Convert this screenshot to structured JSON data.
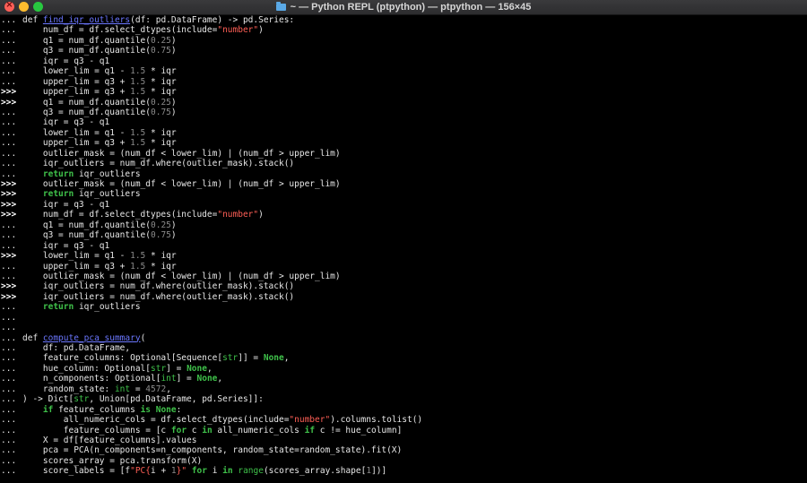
{
  "window": {
    "title": "~ — Python REPL (ptpython) — ptpython — 156×45",
    "folder_icon": "folder-icon"
  },
  "terminal": {
    "lines": [
      {
        "p": "...",
        "t": [
          [
            "",
            "def "
          ],
          [
            "fn",
            "find_iqr_outliers"
          ],
          [
            "",
            "(df: pd.DataFrame) -> pd.Series:"
          ]
        ]
      },
      {
        "p": "...",
        "t": [
          [
            "",
            "    num_df = df.select_dtypes(include="
          ],
          [
            "str",
            "\"number\""
          ],
          [
            "",
            ")"
          ]
        ]
      },
      {
        "p": "...",
        "t": [
          [
            "",
            "    q1 = num_df.quantile("
          ],
          [
            "num",
            "0.25"
          ],
          [
            "",
            ")"
          ]
        ]
      },
      {
        "p": "...",
        "t": [
          [
            "",
            "    q3 = num_df.quantile("
          ],
          [
            "num",
            "0.75"
          ],
          [
            "",
            ")"
          ]
        ]
      },
      {
        "p": "...",
        "t": [
          [
            "",
            "    iqr = q3 - q1"
          ]
        ]
      },
      {
        "p": "...",
        "t": [
          [
            "",
            "    lower_lim = q1 - "
          ],
          [
            "num",
            "1.5"
          ],
          [
            "",
            " * iqr"
          ]
        ]
      },
      {
        "p": "...",
        "t": [
          [
            "",
            "    upper_lim = q3 + "
          ],
          [
            "num",
            "1.5"
          ],
          [
            "",
            " * iqr"
          ]
        ]
      },
      {
        "p": ">>>",
        "t": [
          [
            "",
            "    upper_lim = q3 + "
          ],
          [
            "num",
            "1.5"
          ],
          [
            "",
            " * iqr"
          ]
        ]
      },
      {
        "p": ">>>",
        "t": [
          [
            "",
            "    q1 = num_df.quantile("
          ],
          [
            "num",
            "0.25"
          ],
          [
            "",
            ")"
          ]
        ]
      },
      {
        "p": "...",
        "t": [
          [
            "",
            "    q3 = num_df.quantile("
          ],
          [
            "num",
            "0.75"
          ],
          [
            "",
            ")"
          ]
        ]
      },
      {
        "p": "...",
        "t": [
          [
            "",
            "    iqr = q3 - q1"
          ]
        ]
      },
      {
        "p": "...",
        "t": [
          [
            "",
            "    lower_lim = q1 - "
          ],
          [
            "num",
            "1.5"
          ],
          [
            "",
            " * iqr"
          ]
        ]
      },
      {
        "p": "...",
        "t": [
          [
            "",
            "    upper_lim = q3 + "
          ],
          [
            "num",
            "1.5"
          ],
          [
            "",
            " * iqr"
          ]
        ]
      },
      {
        "p": "...",
        "t": [
          [
            "",
            "    outlier_mask = (num_df < lower_lim) | (num_df > upper_lim)"
          ]
        ]
      },
      {
        "p": "...",
        "t": [
          [
            "",
            "    iqr_outliers = num_df.where(outlier_mask).stack()"
          ]
        ]
      },
      {
        "p": "...",
        "t": [
          [
            "",
            "    "
          ],
          [
            "kw",
            "return"
          ],
          [
            "",
            " iqr_outliers"
          ]
        ]
      },
      {
        "p": ">>>",
        "t": [
          [
            "",
            "    outlier_mask = (num_df < lower_lim) | (num_df > upper_lim)"
          ]
        ]
      },
      {
        "p": ">>>",
        "t": [
          [
            "",
            "    "
          ],
          [
            "kw",
            "return"
          ],
          [
            "",
            " iqr_outliers"
          ]
        ]
      },
      {
        "p": ">>>",
        "t": [
          [
            "",
            "    iqr = q3 - q1"
          ]
        ]
      },
      {
        "p": ">>>",
        "t": [
          [
            "",
            "    num_df = df.select_dtypes(include="
          ],
          [
            "str",
            "\"number\""
          ],
          [
            "",
            ")"
          ]
        ]
      },
      {
        "p": "...",
        "t": [
          [
            "",
            "    q1 = num_df.quantile("
          ],
          [
            "num",
            "0.25"
          ],
          [
            "",
            ")"
          ]
        ]
      },
      {
        "p": "...",
        "t": [
          [
            "",
            "    q3 = num_df.quantile("
          ],
          [
            "num",
            "0.75"
          ],
          [
            "",
            ")"
          ]
        ]
      },
      {
        "p": "...",
        "t": [
          [
            "",
            "    iqr = q3 - q1"
          ]
        ]
      },
      {
        "p": ">>>",
        "t": [
          [
            "",
            "    lower_lim = q1 - "
          ],
          [
            "num",
            "1.5"
          ],
          [
            "",
            " * iqr"
          ]
        ]
      },
      {
        "p": "...",
        "t": [
          [
            "",
            "    upper_lim = q3 + "
          ],
          [
            "num",
            "1.5"
          ],
          [
            "",
            " * iqr"
          ]
        ]
      },
      {
        "p": "...",
        "t": [
          [
            "",
            "    outlier_mask = (num_df < lower_lim) | (num_df > upper_lim)"
          ]
        ]
      },
      {
        "p": ">>>",
        "t": [
          [
            "",
            "    iqr_outliers = num_df.where(outlier_mask).stack()"
          ]
        ]
      },
      {
        "p": ">>>",
        "t": [
          [
            "",
            "    iqr_outliers = num_df.where(outlier_mask).stack()"
          ]
        ]
      },
      {
        "p": "...",
        "t": [
          [
            "",
            "    "
          ],
          [
            "kw",
            "return"
          ],
          [
            "",
            " iqr_outliers"
          ]
        ]
      },
      {
        "p": "...",
        "t": []
      },
      {
        "p": "...",
        "t": []
      },
      {
        "p": "...",
        "t": [
          [
            "",
            "def "
          ],
          [
            "fn",
            "compute_pca_summary"
          ],
          [
            "",
            "("
          ]
        ]
      },
      {
        "p": "...",
        "t": [
          [
            "",
            "    df: pd.DataFrame,"
          ]
        ]
      },
      {
        "p": "...",
        "t": [
          [
            "",
            "    feature_columns: Optional[Sequence["
          ],
          [
            "ty",
            "str"
          ],
          [
            "",
            "]] = "
          ],
          [
            "kw",
            "None"
          ],
          [
            "",
            ","
          ]
        ]
      },
      {
        "p": "...",
        "t": [
          [
            "",
            "    hue_column: Optional["
          ],
          [
            "ty",
            "str"
          ],
          [
            "",
            "] = "
          ],
          [
            "kw",
            "None"
          ],
          [
            "",
            ","
          ]
        ]
      },
      {
        "p": "...",
        "t": [
          [
            "",
            "    n_components: Optional["
          ],
          [
            "ty",
            "int"
          ],
          [
            "",
            "] = "
          ],
          [
            "kw",
            "None"
          ],
          [
            "",
            ","
          ]
        ]
      },
      {
        "p": "...",
        "t": [
          [
            "",
            "    random_state: "
          ],
          [
            "ty",
            "int"
          ],
          [
            "",
            " = "
          ],
          [
            "num",
            "4572"
          ],
          [
            "",
            ","
          ]
        ]
      },
      {
        "p": "...",
        "t": [
          [
            "",
            ") -> Dict["
          ],
          [
            "ty",
            "str"
          ],
          [
            "",
            ", Union[pd.DataFrame, pd.Series]]:"
          ]
        ]
      },
      {
        "p": "...",
        "t": [
          [
            "",
            "    "
          ],
          [
            "kw",
            "if"
          ],
          [
            "",
            " feature_columns "
          ],
          [
            "kw",
            "is None"
          ],
          [
            "",
            ":"
          ]
        ]
      },
      {
        "p": "...",
        "t": [
          [
            "",
            "        all_numeric_cols = df.select_dtypes(include="
          ],
          [
            "str",
            "\"number\""
          ],
          [
            "",
            ").columns.tolist()"
          ]
        ]
      },
      {
        "p": "...",
        "t": [
          [
            "",
            "        feature_columns = [c "
          ],
          [
            "kw",
            "for"
          ],
          [
            "",
            " c "
          ],
          [
            "kw",
            "in"
          ],
          [
            "",
            " all_numeric_cols "
          ],
          [
            "kw",
            "if"
          ],
          [
            "",
            " c != hue_column]"
          ]
        ]
      },
      {
        "p": "...",
        "t": [
          [
            "",
            "    X = df[feature_columns].values"
          ]
        ]
      },
      {
        "p": "...",
        "t": [
          [
            "",
            "    pca = PCA(n_components=n_components, random_state=random_state).fit(X)"
          ]
        ]
      },
      {
        "p": "...",
        "t": [
          [
            "",
            "    scores_array = pca.transform(X)"
          ]
        ]
      },
      {
        "p": "...",
        "t": [
          [
            "",
            "    score_labels = [f"
          ],
          [
            "str",
            "\"PC{"
          ],
          [
            "",
            "i + "
          ],
          [
            "num",
            "1"
          ],
          [
            "str",
            "}\""
          ],
          [
            "",
            " "
          ],
          [
            "kw",
            "for"
          ],
          [
            "",
            " i "
          ],
          [
            "kw",
            "in"
          ],
          [
            "",
            " "
          ],
          [
            "ty",
            "range"
          ],
          [
            "",
            "(scores_array.shape["
          ],
          [
            "num",
            "1"
          ],
          [
            "",
            "])]"
          ]
        ]
      }
    ]
  }
}
